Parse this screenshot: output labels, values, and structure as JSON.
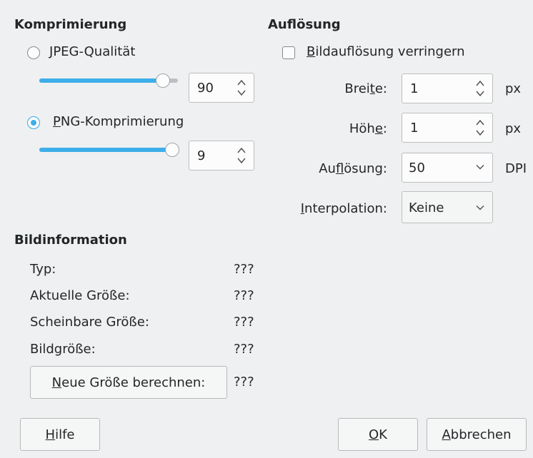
{
  "compression": {
    "heading": "Komprimierung",
    "jpeg": {
      "mnemonic": "J",
      "label_rest": "PEG-Qualität",
      "selected": false,
      "slider_fraction": 0.9,
      "value": "90"
    },
    "png": {
      "mnemonic": "P",
      "label_rest": "NG-Komprimierung",
      "selected": true,
      "slider_fraction": 1.0,
      "value": "9"
    }
  },
  "resolution": {
    "heading": "Auflösung",
    "reduce": {
      "mnemonic": "B",
      "label_rest": "ildauflösung verringern",
      "checked": false
    },
    "width": {
      "label_pre": "Brei",
      "mnemonic": "t",
      "label_post": "e:",
      "value": "1",
      "unit": "px"
    },
    "height": {
      "label_pre": "Höh",
      "mnemonic": "e",
      "label_post": ":",
      "value": "1",
      "unit": "px"
    },
    "dpi": {
      "label_pre": "Au",
      "mnemonic": "f",
      "label_post": "lösung:",
      "value": "50",
      "unit": "DPI"
    },
    "interpolation": {
      "label_pre": "",
      "mnemonic": "I",
      "label_post": "nterpolation:",
      "value": "Keine"
    }
  },
  "info": {
    "heading": "Bildinformation",
    "rows": [
      {
        "label": "Typ:",
        "value": "???"
      },
      {
        "label": "Aktuelle Größe:",
        "value": "???"
      },
      {
        "label": "Scheinbare Größe:",
        "value": "???"
      },
      {
        "label": "Bildgröße:",
        "value": "???"
      }
    ],
    "calc_button": {
      "mnemonic": "N",
      "label_rest": "eue Größe berechnen:",
      "value": "???"
    }
  },
  "buttons": {
    "help": {
      "mnemonic": "H",
      "label_rest": "ilfe"
    },
    "ok": {
      "mnemonic": "O",
      "label_rest": "K"
    },
    "cancel": {
      "mnemonic": "A",
      "label_rest": "bbrechen"
    }
  },
  "colors": {
    "accent": "#3daee9",
    "window_bg": "#eff0f1",
    "text": "#232627"
  }
}
